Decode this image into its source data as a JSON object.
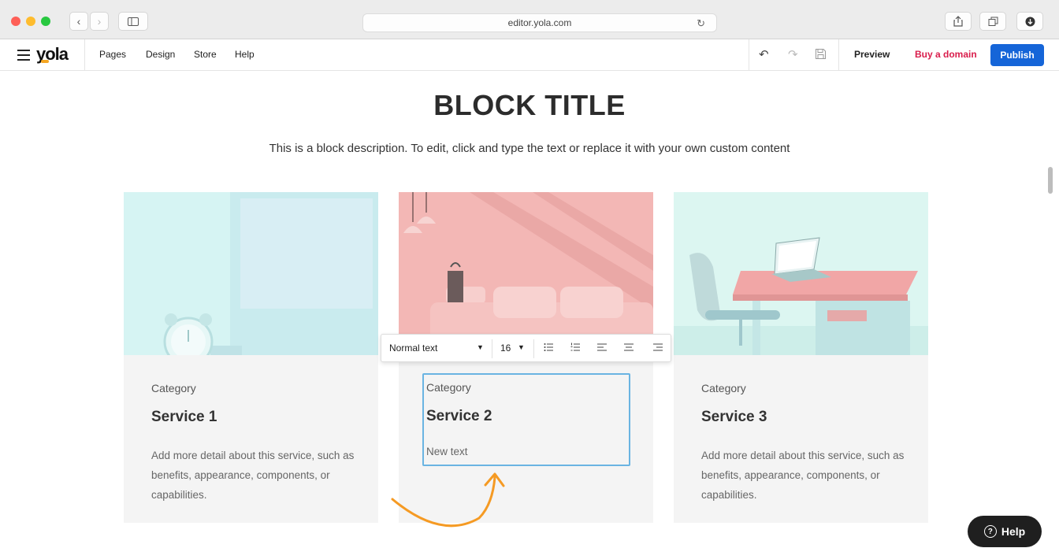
{
  "browser": {
    "url": "editor.yola.com"
  },
  "editor": {
    "logo": "yola",
    "nav": [
      "Pages",
      "Design",
      "Store",
      "Help"
    ],
    "preview_label": "Preview",
    "buy_domain_label": "Buy a domain",
    "publish_label": "Publish"
  },
  "block": {
    "title": "BLOCK TITLE",
    "description": "This is a block description. To edit, click and type the text or replace it with your own custom content"
  },
  "cards": [
    {
      "category": "Category",
      "title": "Service 1",
      "description": "Add more detail about this service, such as benefits, appearance, components, or capabilities."
    },
    {
      "category": "Category",
      "title": "Service 2",
      "description": "New text"
    },
    {
      "category": "Category",
      "title": "Service 3",
      "description": "Add more detail about this service, such as benefits, appearance, components, or capabilities."
    }
  ],
  "format_toolbar": {
    "text_style": "Normal text",
    "font_size": "16"
  },
  "help_button": {
    "label": "Help"
  },
  "colors": {
    "publish": "#1565d8",
    "buy_domain": "#d91c4b",
    "edit_frame": "#6ab4e2",
    "arrow": "#f59a23"
  }
}
